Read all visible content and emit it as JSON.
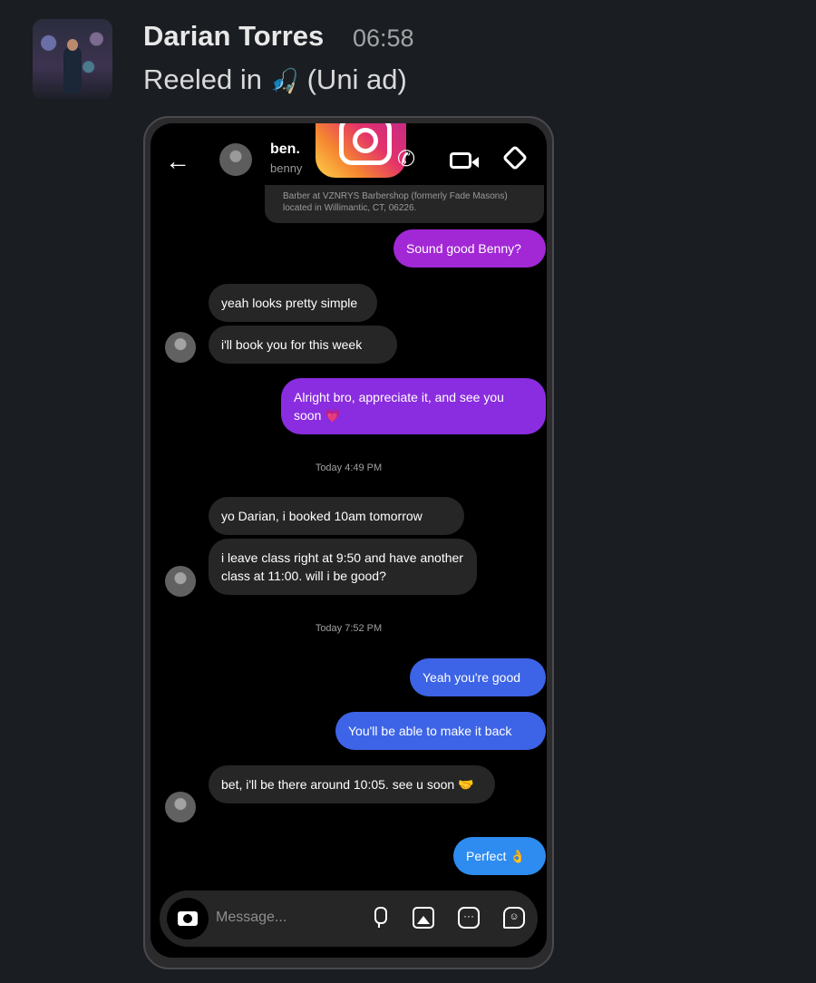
{
  "message": {
    "sender": "Darian Torres",
    "time": "06:58",
    "text_before": "Reeled in",
    "emoji": "🎣",
    "text_after": "(Uni ad)"
  },
  "attachment": {
    "header": {
      "contact_name": "ben.",
      "contact_username": "benny"
    },
    "messages": [
      {
        "side": "in",
        "text": "Barber at VZNRYS Barbershop (formerly Fade Masons) located in Willimantic, CT, 06226."
      },
      {
        "side": "out",
        "color": "#a228d6",
        "text": "Sound good Benny?"
      },
      {
        "side": "in",
        "text": "yeah looks pretty simple"
      },
      {
        "side": "in",
        "text": "i'll book you for this week"
      },
      {
        "side": "out",
        "color": "#8a2de0",
        "text": "Alright bro, appreciate it, and see you soon 💗"
      },
      {
        "type": "timestamp",
        "text": "Today 4:49 PM"
      },
      {
        "side": "in",
        "text": "yo Darian, i booked 10am tomorrow"
      },
      {
        "side": "in",
        "text": "i leave class right at 9:50 and have another class at 11:00. will i be good?"
      },
      {
        "type": "timestamp",
        "text": "Today 7:52 PM"
      },
      {
        "side": "out",
        "color": "#3d64e6",
        "text": "Yeah you're good"
      },
      {
        "side": "out",
        "color": "#3d64e6",
        "text": "You'll be able to make it back"
      },
      {
        "side": "in",
        "text": "bet, i'll be there around 10:05. see u soon 🤝"
      },
      {
        "side": "out",
        "color": "#2e8cf0",
        "text": "Perfect 👌"
      }
    ],
    "input_placeholder": "Message..."
  },
  "colors": {
    "background": "#1a1d21",
    "outgoing_purple": "#a228d6",
    "outgoing_blue": "#3d64e6",
    "outgoing_sky": "#2e8cf0",
    "incoming": "#262626"
  },
  "icons": [
    "back-arrow-icon",
    "instagram-logo-icon",
    "phone-call-icon",
    "video-call-icon",
    "tag-icon",
    "camera-icon",
    "microphone-icon",
    "gallery-icon",
    "chat-icon",
    "sticker-icon"
  ]
}
